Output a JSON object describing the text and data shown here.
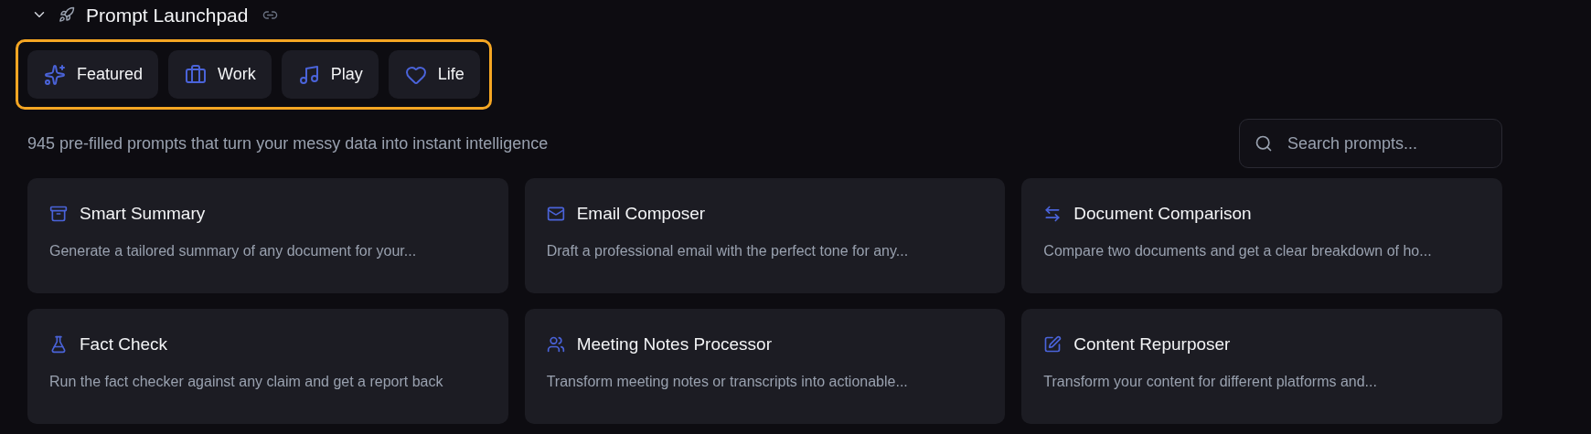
{
  "section": {
    "title": "Prompt Launchpad",
    "expanded": true
  },
  "category_tabs": {
    "focused": true,
    "tabs": [
      {
        "label": "Featured",
        "selected": false
      },
      {
        "label": "Work",
        "selected": false
      },
      {
        "label": "Play",
        "selected": false
      },
      {
        "label": "Life",
        "selected": false
      }
    ]
  },
  "description": "945 pre-filled prompts that turn your messy data into instant intelligence",
  "search": {
    "placeholder": "Search prompts..."
  },
  "cards": [
    {
      "title": "Smart Summary",
      "description": "Generate a tailored summary of any document for your..."
    },
    {
      "title": "Email Composer",
      "description": "Draft a professional email with the perfect tone for any..."
    },
    {
      "title": "Document Comparison",
      "description": "Compare two documents and get a clear breakdown of ho..."
    },
    {
      "title": "Fact Check",
      "description": "Run the fact checker against any claim and get a report back"
    },
    {
      "title": "Meeting Notes Processor",
      "description": "Transform meeting notes or transcripts into actionable..."
    },
    {
      "title": "Content Repurposer",
      "description": "Transform your content for different platforms and..."
    }
  ]
}
